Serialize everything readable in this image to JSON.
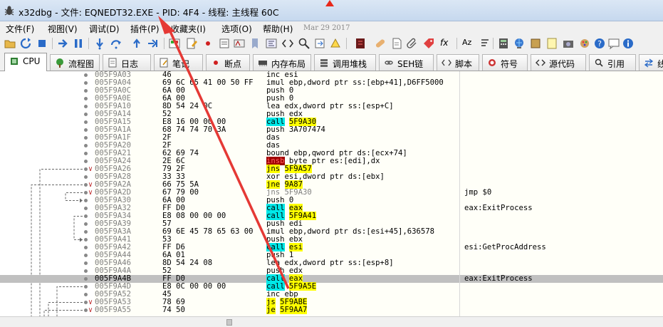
{
  "window": {
    "title": "x32dbg - 文件: EQNEDT32.EXE - PID: 4F4 - 线程: 主线程 60C"
  },
  "menu": {
    "items": [
      "文件(F)",
      "视图(V)",
      "调试(D)",
      "插件(P)",
      "收藏夹(I)",
      "选项(O)",
      "帮助(H)"
    ],
    "date": "Mar 29 2017"
  },
  "toolbar": {
    "fx_label": "fx",
    "az_label": "Aᴢ"
  },
  "tabs": [
    {
      "label": "CPU",
      "icon": "cpu-icon"
    },
    {
      "label": "流程图",
      "icon": "tree-icon"
    },
    {
      "label": "日志",
      "icon": "log-icon"
    },
    {
      "label": "笔记",
      "icon": "notes-icon"
    },
    {
      "label": "断点",
      "icon": "breakpoint-icon"
    },
    {
      "label": "内存布局",
      "icon": "memory-icon"
    },
    {
      "label": "调用堆栈",
      "icon": "callstack-icon"
    },
    {
      "label": "SEH链",
      "icon": "seh-icon"
    },
    {
      "label": "脚本",
      "icon": "script-icon"
    },
    {
      "label": "符号",
      "icon": "symbols-icon"
    },
    {
      "label": "源代码",
      "icon": "source-icon"
    },
    {
      "label": "引用",
      "icon": "references-icon"
    },
    {
      "label": "线",
      "icon": "threads-icon"
    }
  ],
  "disassembly": [
    {
      "addr": "005F9A03",
      "bytes": "46",
      "asm": "inc esi",
      "cmt": ""
    },
    {
      "addr": "005F9A04",
      "bytes": "69 6C 65 41 00 50 FF",
      "asm": "imul ebp,dword ptr ss:[ebp+41],D6FF5000",
      "cmt": ""
    },
    {
      "addr": "005F9A0C",
      "bytes": "6A 00",
      "asm": "push 0",
      "cmt": ""
    },
    {
      "addr": "005F9A0E",
      "bytes": "6A 00",
      "asm": "push 0",
      "cmt": ""
    },
    {
      "addr": "005F9A10",
      "bytes": "8D 54 24 0C",
      "asm": "lea edx,dword ptr ss:[esp+C]",
      "cmt": ""
    },
    {
      "addr": "005F9A14",
      "bytes": "52",
      "asm": "push edx",
      "cmt": ""
    },
    {
      "addr": "005F9A15",
      "bytes": "E8 16 00 00 00",
      "asm": "call 5F9A30",
      "cmt": ""
    },
    {
      "addr": "005F9A1A",
      "bytes": "68 74 74 70 3A",
      "asm": "push 3A707474",
      "cmt": ""
    },
    {
      "addr": "005F9A1F",
      "bytes": "2F",
      "asm": "das",
      "cmt": ""
    },
    {
      "addr": "005F9A20",
      "bytes": "2F",
      "asm": "das",
      "cmt": ""
    },
    {
      "addr": "005F9A21",
      "bytes": "62 69 74",
      "asm": "bound ebp,qword ptr ds:[ecx+74]",
      "cmt": ""
    },
    {
      "addr": "005F9A24",
      "bytes": "2E 6C",
      "asm": "insb byte ptr es:[edi],dx",
      "cmt": ""
    },
    {
      "addr": "005F9A26",
      "bytes": "79 2F",
      "asm": "jns 5F9A57",
      "cmt": ""
    },
    {
      "addr": "005F9A28",
      "bytes": "33 33",
      "asm": "xor esi,dword ptr ds:[ebx]",
      "cmt": ""
    },
    {
      "addr": "005F9A2A",
      "bytes": "66 75 5A",
      "asm": "jne 9A87",
      "cmt": ""
    },
    {
      "addr": "005F9A2D",
      "bytes": "67 79 00",
      "asm": "jns 5F9A30",
      "cmt": "jmp $0"
    },
    {
      "addr": "005F9A30",
      "bytes": "6A 00",
      "asm": "push 0",
      "cmt": ""
    },
    {
      "addr": "005F9A32",
      "bytes": "FF D0",
      "asm": "call eax",
      "cmt": "eax:ExitProcess"
    },
    {
      "addr": "005F9A34",
      "bytes": "E8 08 00 00 00",
      "asm": "call 5F9A41",
      "cmt": ""
    },
    {
      "addr": "005F9A39",
      "bytes": "57",
      "asm": "push edi",
      "cmt": ""
    },
    {
      "addr": "005F9A3A",
      "bytes": "69 6E 45 78 65 63 00",
      "asm": "imul ebp,dword ptr ds:[esi+45],636578",
      "cmt": ""
    },
    {
      "addr": "005F9A41",
      "bytes": "53",
      "asm": "push ebx",
      "cmt": ""
    },
    {
      "addr": "005F9A42",
      "bytes": "FF D6",
      "asm": "call esi",
      "cmt": "esi:GetProcAddress"
    },
    {
      "addr": "005F9A44",
      "bytes": "6A 01",
      "asm": "push 1",
      "cmt": ""
    },
    {
      "addr": "005F9A46",
      "bytes": "8D 54 24 08",
      "asm": "lea edx,dword ptr ss:[esp+8]",
      "cmt": ""
    },
    {
      "addr": "005F9A4A",
      "bytes": "52",
      "asm": "push edx",
      "cmt": ""
    },
    {
      "addr": "005F9A4B",
      "bytes": "FF D0",
      "asm": "call eax",
      "cmt": "eax:ExitProcess"
    },
    {
      "addr": "005F9A4D",
      "bytes": "E8 0C 00 00 00",
      "asm": "call 5F9A5E",
      "cmt": ""
    },
    {
      "addr": "005F9A52",
      "bytes": "45",
      "asm": "inc ebp",
      "cmt": ""
    },
    {
      "addr": "005F9A53",
      "bytes": "78 69",
      "asm": "js 5F9ABE",
      "cmt": ""
    },
    {
      "addr": "005F9A55",
      "bytes": "74 50",
      "asm": "je 5F9AA7",
      "cmt": ""
    }
  ]
}
